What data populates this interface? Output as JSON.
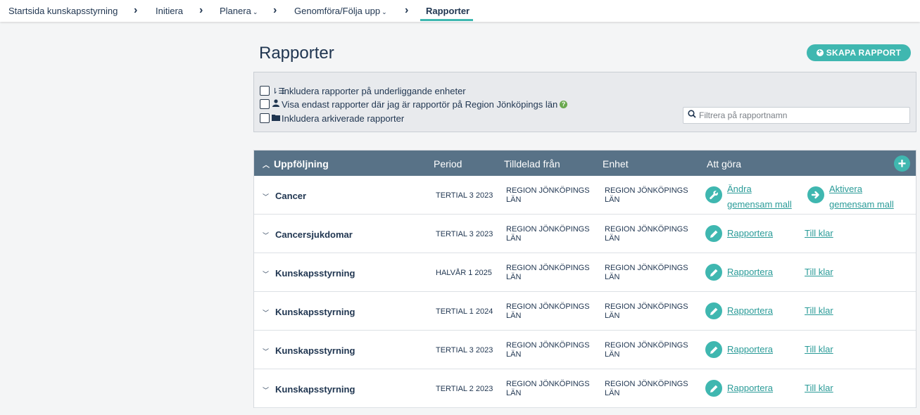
{
  "breadcrumb": {
    "items": [
      {
        "label": "Startsida kunskapsstyrning",
        "dropdown": false
      },
      {
        "label": "Initiera",
        "dropdown": false
      },
      {
        "label": "Planera",
        "dropdown": true
      },
      {
        "label": "Genomföra/Följa upp",
        "dropdown": true
      },
      {
        "label": "Rapporter",
        "dropdown": false,
        "active": true
      }
    ]
  },
  "page": {
    "title": "Rapporter",
    "create_button": "SKAPA RAPPORT"
  },
  "filters": {
    "include_sub_units": {
      "label": "Inkludera rapporter på underliggande enheter",
      "checked": false,
      "icon": "sort-list-icon"
    },
    "only_reporter": {
      "label": "Visa endast rapporter där jag är rapportör på Region Jönköpings län",
      "checked": false,
      "icon": "user-icon"
    },
    "include_archived": {
      "label": "Inkludera arkiverade rapporter",
      "checked": false,
      "icon": "folder-icon"
    },
    "search_placeholder": "Filtrera på rapportnamn"
  },
  "table": {
    "group": "Uppföljning",
    "columns": {
      "period": "Period",
      "assigned_from": "Tilldelad från",
      "unit": "Enhet",
      "todo": "Att göra"
    },
    "rows": [
      {
        "name": "Cancer",
        "period": "TERTIAL 3 2023",
        "assigned_from": "REGION JÖNKÖPINGS LÄN",
        "unit": "REGION JÖNKÖPINGS LÄN",
        "action1": "Ändra gemensam mall",
        "action1_icon": "wrench-icon",
        "action2": "Aktivera gemensam mall",
        "action2_icon": "arrow-right-icon"
      },
      {
        "name": "Cancersjukdomar",
        "period": "TERTIAL 3 2023",
        "assigned_from": "REGION JÖNKÖPINGS LÄN",
        "unit": "REGION JÖNKÖPINGS LÄN",
        "action1": "Rapportera",
        "action1_icon": "pencil-icon",
        "action2": "Till klar"
      },
      {
        "name": "Kunskapsstyrning",
        "period": "HALVÅR 1 2025",
        "assigned_from": "REGION JÖNKÖPINGS LÄN",
        "unit": "REGION JÖNKÖPINGS LÄN",
        "action1": "Rapportera",
        "action1_icon": "pencil-icon",
        "action2": "Till klar"
      },
      {
        "name": "Kunskapsstyrning",
        "period": "TERTIAL 1 2024",
        "assigned_from": "REGION JÖNKÖPINGS LÄN",
        "unit": "REGION JÖNKÖPINGS LÄN",
        "action1": "Rapportera",
        "action1_icon": "pencil-icon",
        "action2": "Till klar"
      },
      {
        "name": "Kunskapsstyrning",
        "period": "TERTIAL 3 2023",
        "assigned_from": "REGION JÖNKÖPINGS LÄN",
        "unit": "REGION JÖNKÖPINGS LÄN",
        "action1": "Rapportera",
        "action1_icon": "pencil-icon",
        "action2": "Till klar"
      },
      {
        "name": "Kunskapsstyrning",
        "period": "TERTIAL 2 2023",
        "assigned_from": "REGION JÖNKÖPINGS LÄN",
        "unit": "REGION JÖNKÖPINGS LÄN",
        "action1": "Rapportera",
        "action1_icon": "pencil-icon",
        "action2": "Till klar"
      }
    ]
  },
  "colors": {
    "accent": "#3fb7b0",
    "header": "#587287",
    "text": "#1f3550",
    "help": "#6aa84f"
  }
}
